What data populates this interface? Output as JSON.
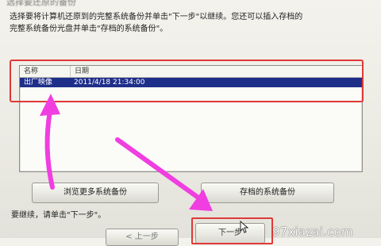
{
  "title_partial": "选择要还原的备份",
  "instruction": {
    "line1": "选择要将计算机还原到的完整系统备份并单击\"下一步\"以继续。您还可以插入存档的",
    "line2": "完整系统备份光盘并单击\"存档的系统备份\"。"
  },
  "backup_list": {
    "columns": [
      "名称",
      "日期"
    ],
    "rows": [
      {
        "name": "出厂映像",
        "date": "2011/4/18 21:34:00"
      }
    ]
  },
  "buttons": {
    "browse": "浏览更多系统备份",
    "archived": "存档的系统备份",
    "back": "< 上一步",
    "next": "下一步"
  },
  "continue_hint": "要继续，请单击\"下一步\"。",
  "watermark": "97xiazai.com",
  "colors": {
    "annotation_red": "#e03838",
    "arrow_magenta": "#f03ee0",
    "selection_blue": "#1e2f8a"
  }
}
